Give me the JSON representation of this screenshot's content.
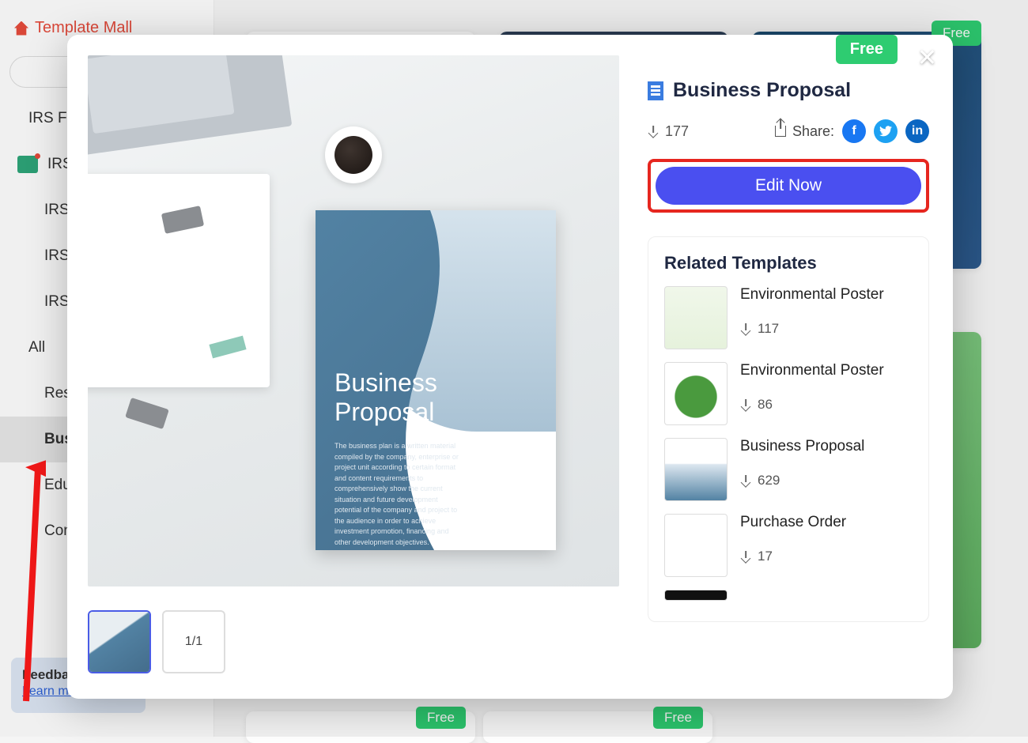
{
  "window": {
    "minimize": "—",
    "close": "✕"
  },
  "sidebar": {
    "title": "Template Mall",
    "items": [
      {
        "label": "IRS Fo"
      },
      {
        "label": "IRS"
      },
      {
        "label": "IRS"
      },
      {
        "label": "IRS"
      },
      {
        "label": "IRS"
      },
      {
        "label": "All"
      },
      {
        "label": "Res"
      },
      {
        "label": "Bus"
      },
      {
        "label": "Edu"
      },
      {
        "label": "Con"
      }
    ],
    "feedback": {
      "title": "Feedba",
      "link": "Learn mo"
    }
  },
  "bg_cards": {
    "free": "Free"
  },
  "modal": {
    "free_label": "Free",
    "close_label": "✕",
    "title": "Business Proposal",
    "doc_title_line1": "Business",
    "doc_title_line2": "Proposal",
    "doc_desc": "The business plan is a written material compiled by the company, enterprise or project unit according to certain format and content requirements to comprehensively show the current situation and future development potential of the company and project to the audience in order to achieve investment promotion, financing and other development objectives.",
    "downloads": "177",
    "share_label": "Share:",
    "edit_button": "Edit Now",
    "page_indicator": "1/1",
    "related_title": "Related Templates",
    "related": [
      {
        "name": "Environmental Poster",
        "downloads": "117"
      },
      {
        "name": "Environmental Poster",
        "downloads": "86"
      },
      {
        "name": "Business Proposal",
        "downloads": "629"
      },
      {
        "name": "Purchase Order",
        "downloads": "17"
      }
    ]
  }
}
